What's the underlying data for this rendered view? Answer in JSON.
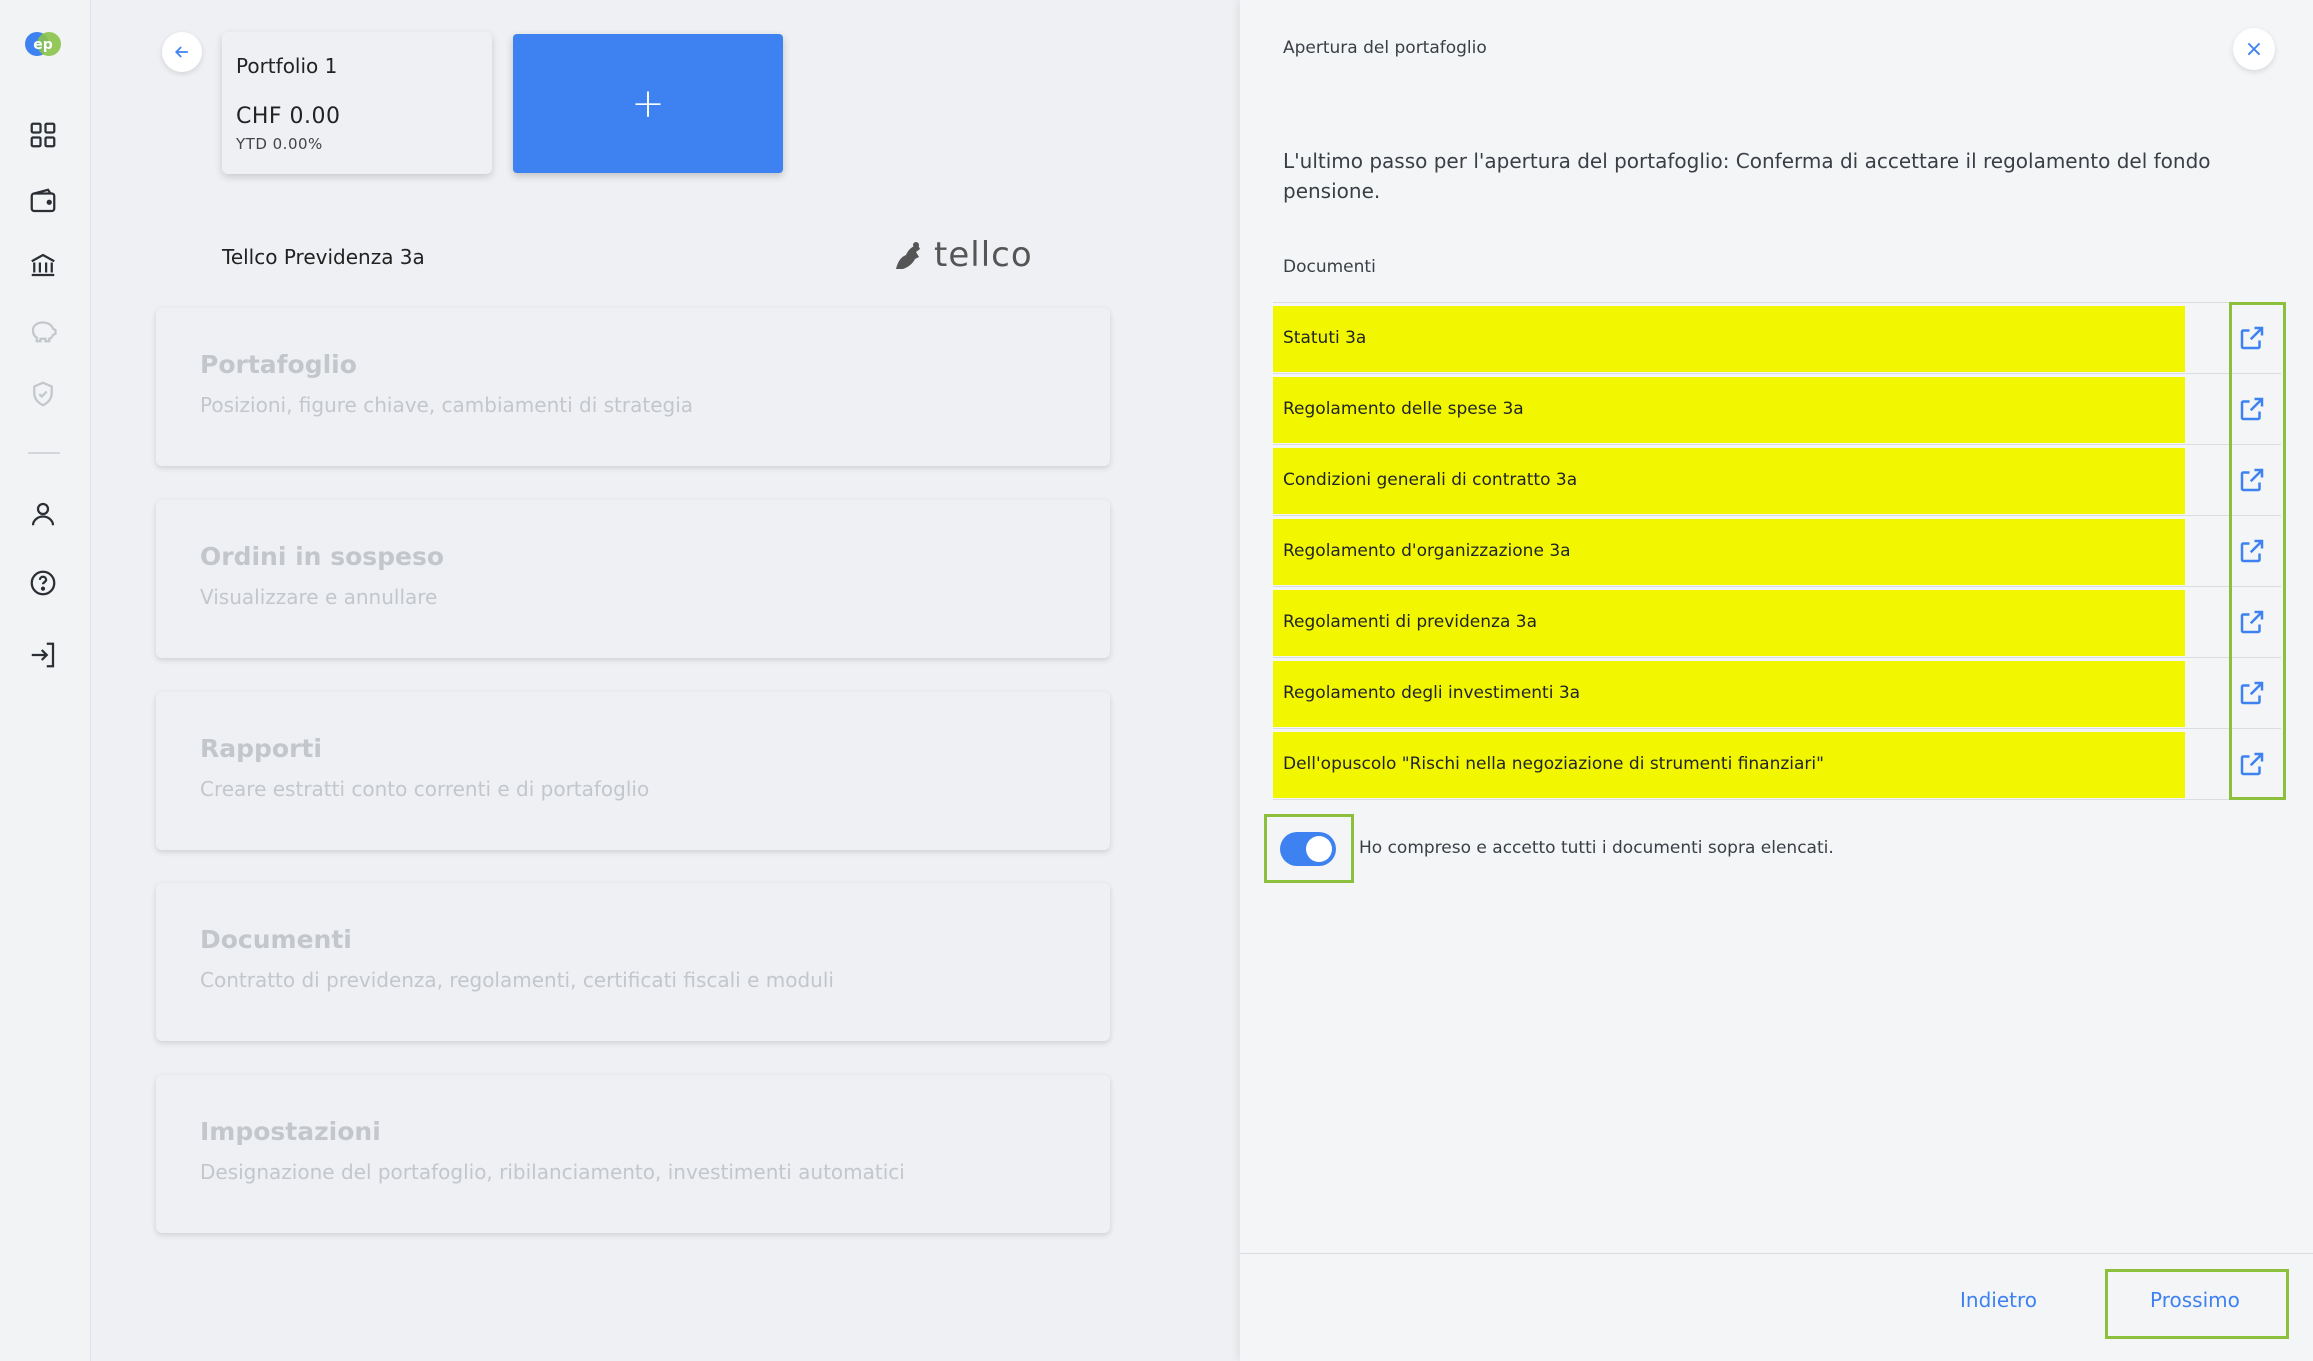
{
  "sidebar": {
    "logo_text": "ep",
    "items": [
      {
        "icon": "dashboard-icon"
      },
      {
        "icon": "wallet-icon"
      },
      {
        "icon": "bank-icon"
      },
      {
        "icon": "piggy-bank-icon"
      },
      {
        "icon": "shield-icon"
      },
      {
        "icon": "user-icon"
      },
      {
        "icon": "help-icon"
      },
      {
        "icon": "logout-icon"
      }
    ]
  },
  "main": {
    "portfolio": {
      "name": "Portfolio 1",
      "amount": "CHF 0.00",
      "ytd": "YTD 0.00%"
    },
    "add_label": "+",
    "provider": {
      "name": "Tellco Previdenza 3a",
      "logo_text": "tellco"
    },
    "menu": [
      {
        "title": "Portafoglio",
        "subtitle": "Posizioni, figure chiave, cambiamenti di strategia"
      },
      {
        "title": "Ordini in sospeso",
        "subtitle": "Visualizzare e annullare"
      },
      {
        "title": "Rapporti",
        "subtitle": "Creare estratti conto correnti e di portafoglio"
      },
      {
        "title": "Documenti",
        "subtitle": "Contratto di previdenza, regolamenti, certificati fiscali e moduli"
      },
      {
        "title": "Impostazioni",
        "subtitle": "Designazione del portafoglio, ribilanciamento, investimenti automatici"
      }
    ]
  },
  "panel": {
    "title": "Apertura del portafoglio",
    "close_label": "×",
    "intro": "L'ultimo passo per l'apertura del portafoglio: Conferma di accettare il regolamento del fondo pensione.",
    "docs_label": "Documenti",
    "documents": [
      {
        "label": "Statuti 3a"
      },
      {
        "label": "Regolamento delle spese 3a"
      },
      {
        "label": "Condizioni generali di contratto 3a"
      },
      {
        "label": "Regolamento d'organizzazione 3a"
      },
      {
        "label": "Regolamenti di previdenza 3a"
      },
      {
        "label": "Regolamento degli investimenti 3a"
      },
      {
        "label": "Dell'opuscolo \"Rischi nella negoziazione di strumenti finanziari\""
      }
    ],
    "accept_text": "Ho compreso e accetto tutti i documenti sopra elencati.",
    "accept_checked": true,
    "back_label": "Indietro",
    "next_label": "Prossimo"
  },
  "colors": {
    "accent": "#3d82f0",
    "highlight": "#f2f700",
    "frame": "#8bbf3c"
  }
}
